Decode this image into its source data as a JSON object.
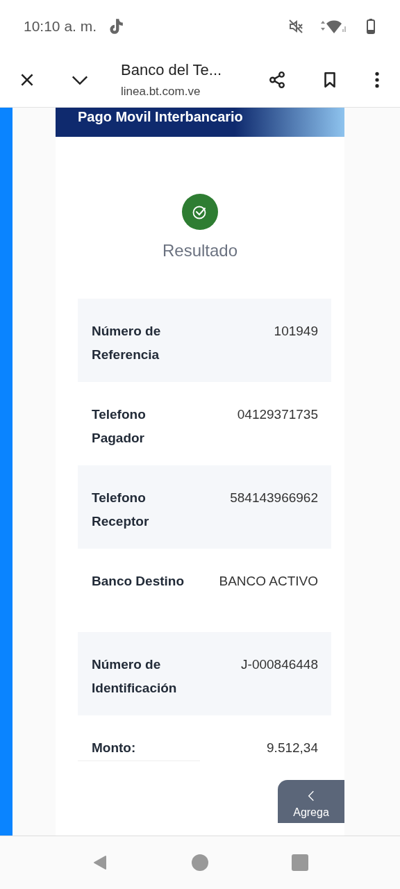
{
  "status_bar": {
    "time": "10:10 a. m."
  },
  "browser": {
    "title": "Banco del Te...",
    "url": "linea.bt.com.ve"
  },
  "page": {
    "banner_title": "Pago Movil Interbancario",
    "result_title": "Resultado",
    "rows": [
      {
        "label": "Número de Referencia",
        "value": "101949"
      },
      {
        "label": "Telefono Pagador",
        "value": "04129371735"
      },
      {
        "label": "Telefono Receptor",
        "value": "584143966962"
      },
      {
        "label": "Banco Destino",
        "value": "BANCO ACTIVO"
      },
      {
        "label": "Número de Identificación",
        "value": "J-000846448"
      },
      {
        "label": "Monto:",
        "value": "9.512,34"
      }
    ],
    "button_label": "Agrega"
  }
}
